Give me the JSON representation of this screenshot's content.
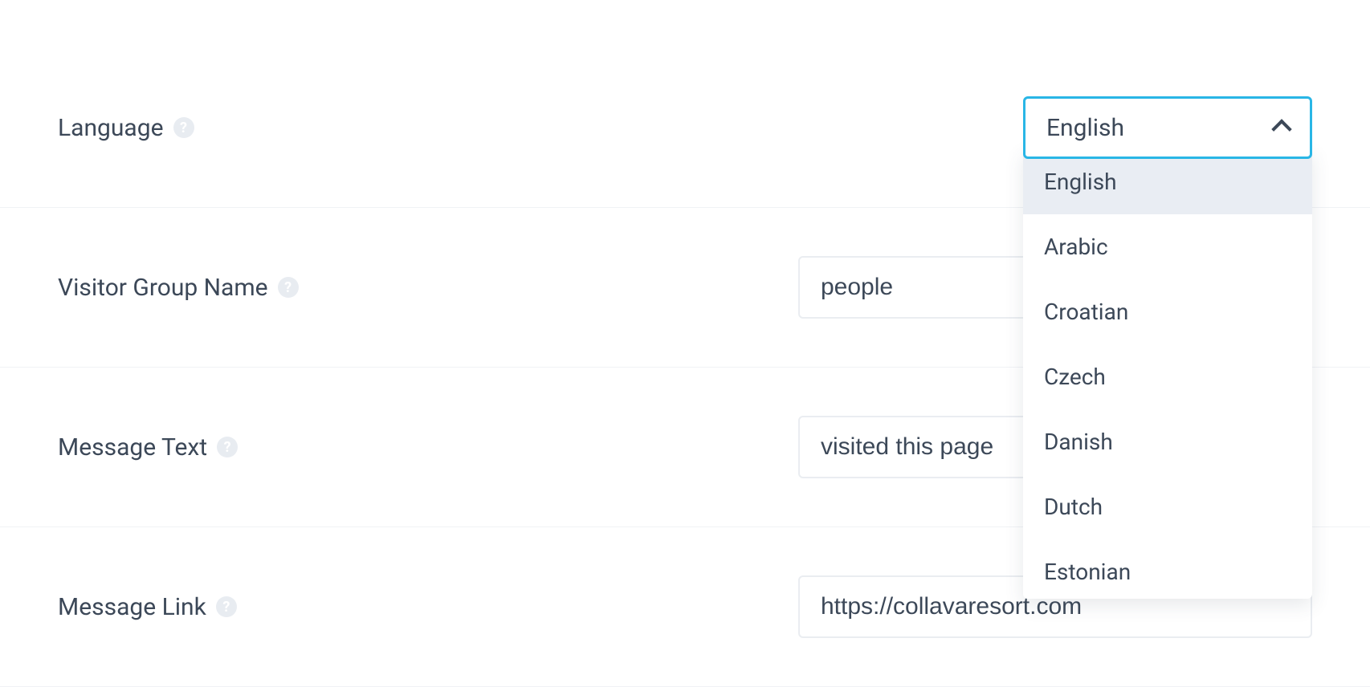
{
  "rows": {
    "language": {
      "label": "Language",
      "selected": "English",
      "options": [
        "English",
        "Arabic",
        "Croatian",
        "Czech",
        "Danish",
        "Dutch",
        "Estonian"
      ]
    },
    "visitor_group_name": {
      "label": "Visitor Group Name",
      "value": "people"
    },
    "message_text": {
      "label": "Message Text",
      "value": "visited this page"
    },
    "message_link": {
      "label": "Message Link",
      "value": "https://collavaresort.com"
    }
  }
}
